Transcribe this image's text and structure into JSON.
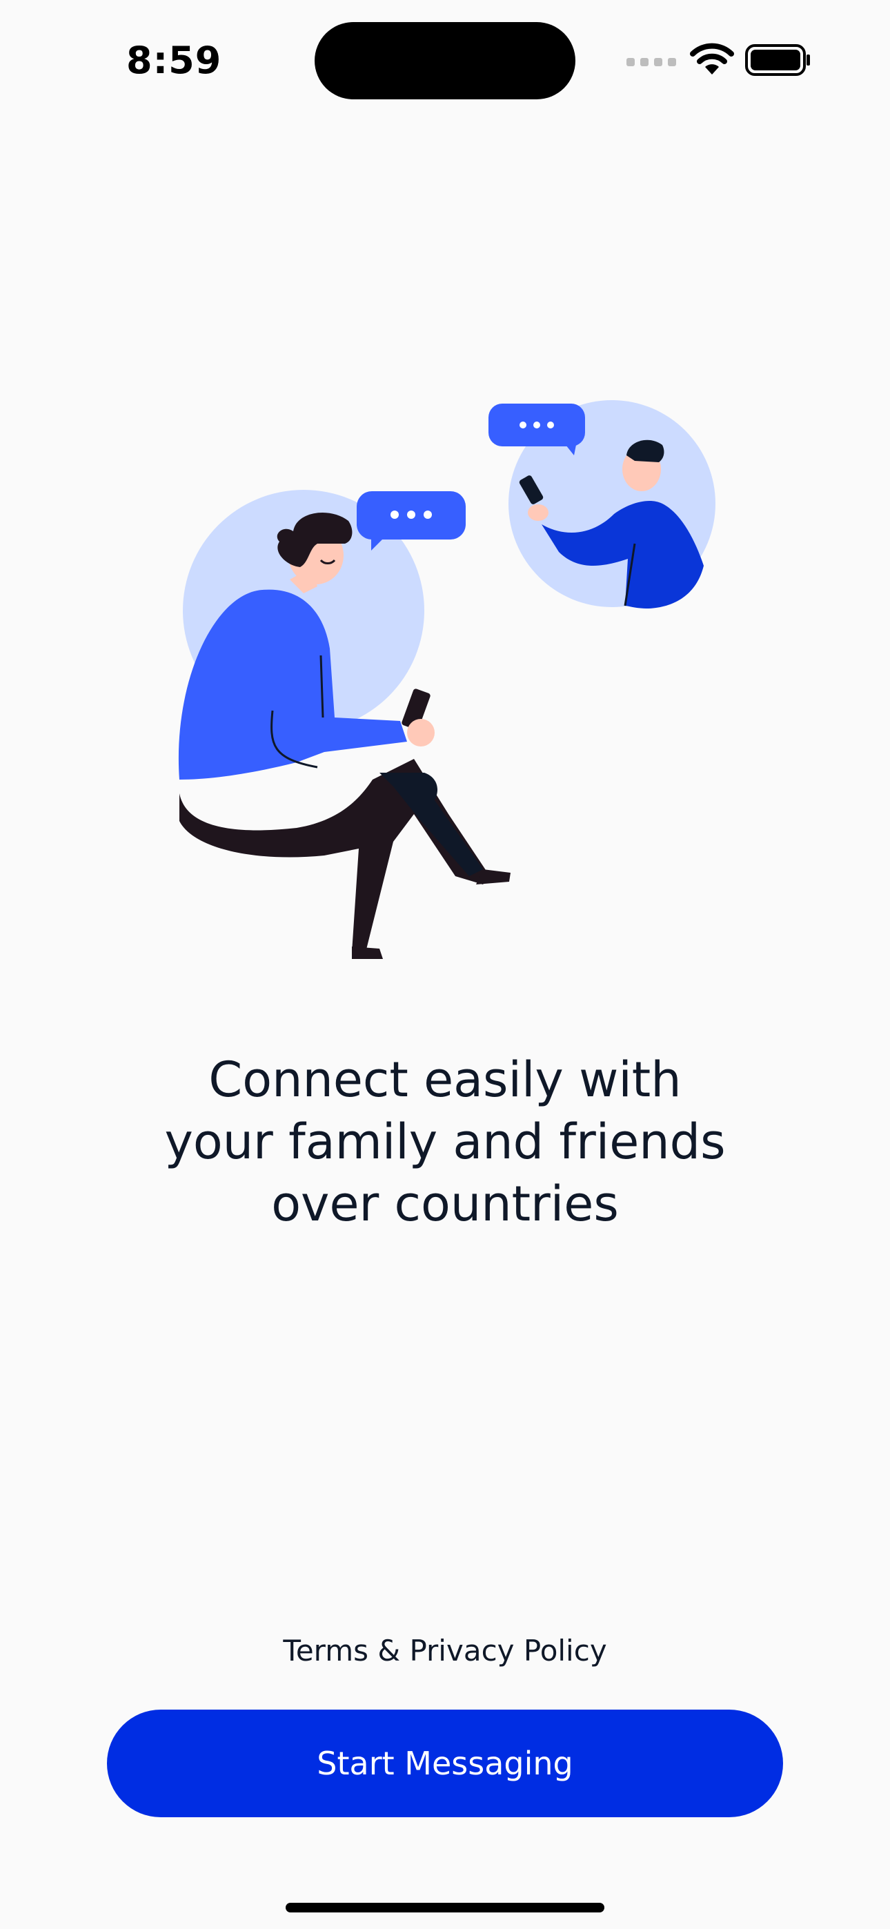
{
  "status_bar": {
    "time": "8:59"
  },
  "illustration": {
    "icon": "people-chatting-illustration"
  },
  "onboarding": {
    "headline_lines": [
      "Connect easily with",
      "your family and friends",
      "over countries"
    ],
    "terms_label": "Terms & Privacy Policy",
    "start_label": "Start Messaging"
  },
  "colors": {
    "accent": "#002DE3",
    "text": "#0F1828",
    "background": "#FAFAFA",
    "illustration_blue": "#375FFF",
    "illustration_light": "#CCDBFF"
  }
}
